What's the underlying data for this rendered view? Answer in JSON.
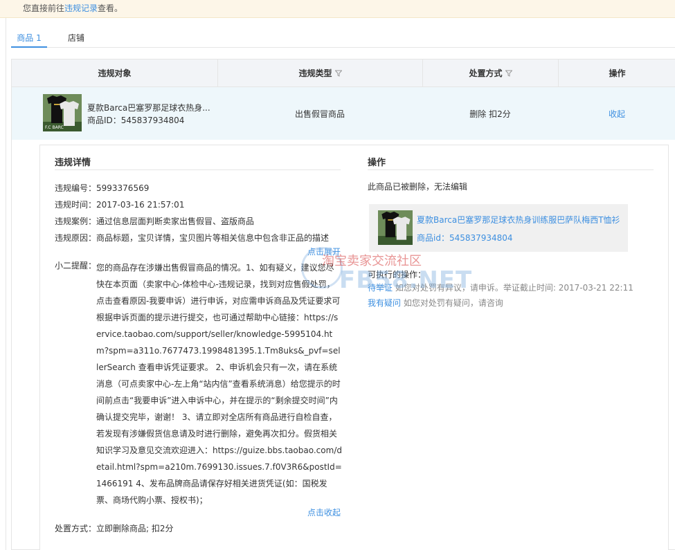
{
  "notice": {
    "prefix": "您直接前往",
    "link": "违规记录",
    "suffix": "查看。"
  },
  "tabs": [
    {
      "label": "商品 1"
    },
    {
      "label": "店铺"
    }
  ],
  "table": {
    "headers": {
      "target": "违规对象",
      "type": "违规类型",
      "handling": "处置方式",
      "action": "操作"
    },
    "row": {
      "product_name": "夏款Barca巴塞罗那足球衣热身...",
      "product_id": "商品ID：545837934804",
      "violation_type": "出售假冒商品",
      "handling": "删除 扣2分",
      "action": "收起"
    }
  },
  "detail": {
    "left_title": "违规详情",
    "number": "违规编号：5993376569",
    "time": "违规时间：2017-03-16 21:57:01",
    "case": "违规案例：通过信息层面判断卖家出售假冒、盗版商品",
    "reason": "违规原因：商品标题，宝贝详情，宝贝图片等相关信息中包含非正品的描述",
    "expand": "点击展开",
    "tip_label": "小二提醒：",
    "tip_text": "您的商品存在涉嫌出售假冒商品的情况。1、如有疑义，建议您尽快在本页面（卖家中心-体检中心-违规记录，找到对应售假处罚，点击查看原因-我要申诉）进行申诉，对应需申诉商品及凭证要求可根据申诉页面的提示进行提交，也可通过帮助中心链接：https://service.taobao.com/support/seller/knowledge-5995104.htm?spm=a311o.7677473.1998481395.1.Tm8uks&_pvf=sellerSearch 查看申诉凭证要求。 2、申诉机会只有一次，请在系统消息（可点卖家中心-左上角“站内信”查看系统消息）给您提示的时间前点击“我要申诉”进入申诉中心，并在提示的“剩余提交时间”内确认提交完毕，谢谢！ 3、请立即对全店所有商品进行自检自查，若发现有涉嫌假货信息请及时进行删除，避免再次扣分。假货相关知识学习及意见交流欢迎进入：https://guize.bbs.taobao.com/detail.html?spm=a210m.7699130.issues.7.f0V3R6&postId=1466191 4、发布品牌商品请保存好相关进货凭证(如：国税发票、商场代购小票、授权书)；",
    "collapse": "点击收起",
    "handling": "处置方式：立即删除商品; 扣2分",
    "right_title": "操作",
    "deleted_note": "此商品已被删除，无法编辑",
    "card_name": "夏款Barca巴塞罗那足球衣热身训练服巴萨队梅西T恤衫",
    "card_id": "商品id：545837934804",
    "ops_label": "可执行的操作：",
    "op1_link": "待举证",
    "op1_text": "如您对处罚有异议，请申诉。举证截止时间: 2017-03-21 22:11",
    "op2_link": "我有疑问",
    "op2_text": "如您对处罚有疑问，请咨询"
  },
  "watermark": {
    "cn": "淘宝卖家交流社区",
    "en": "FB58.NET"
  },
  "colors": {
    "link": "#3d8fe0",
    "notice_bg": "#fdf6e8",
    "header_bg": "#f2f4f7",
    "row_bg": "#eef7fb"
  }
}
